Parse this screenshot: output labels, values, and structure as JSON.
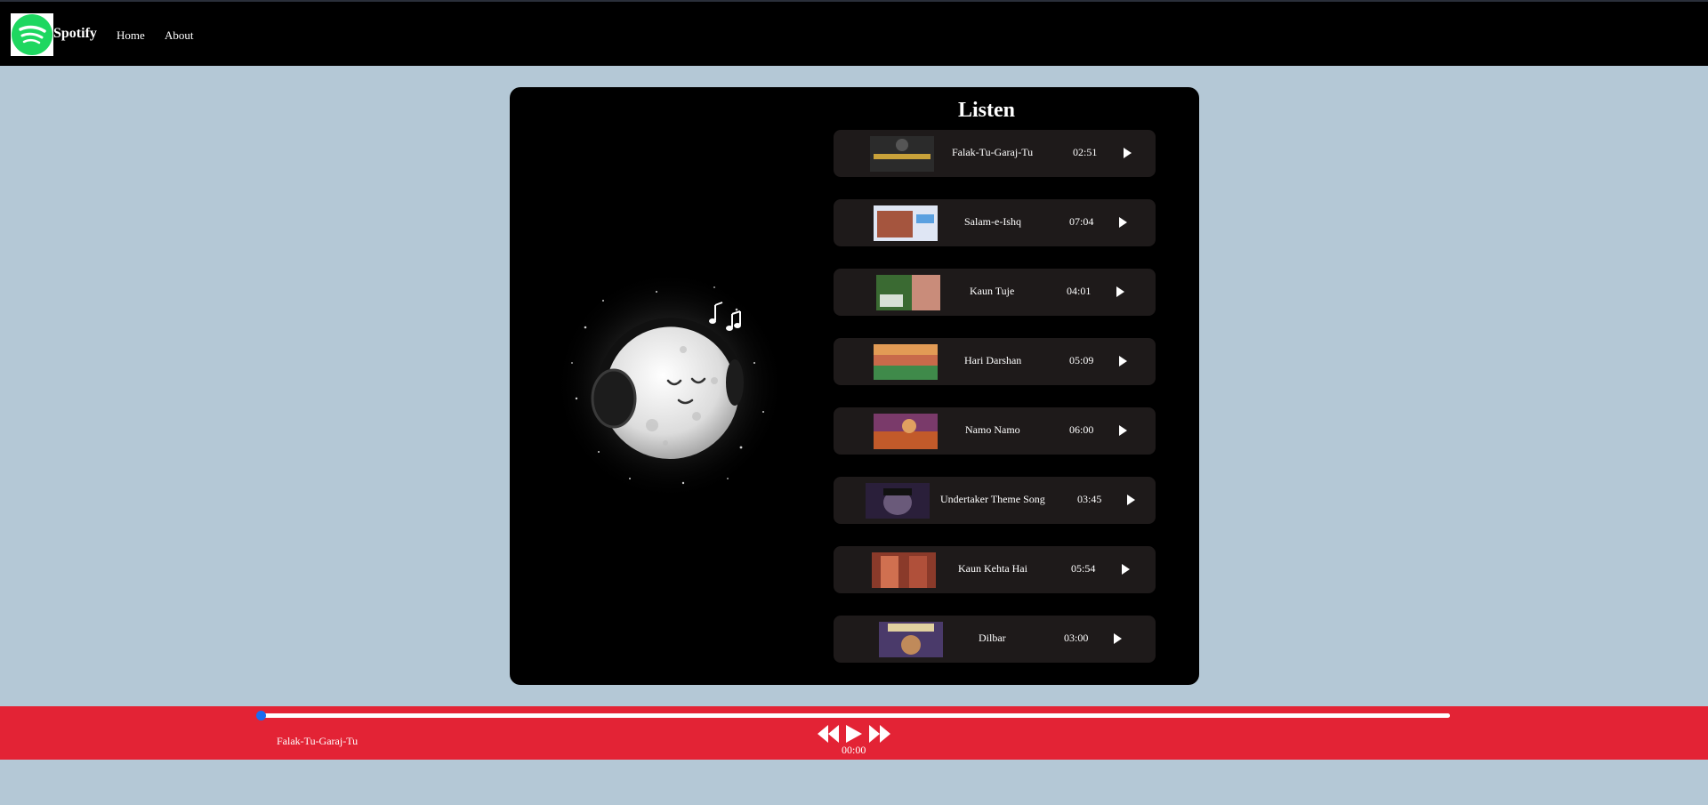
{
  "nav": {
    "brand": "Spotify",
    "links": [
      "Home",
      "About"
    ]
  },
  "playlist": {
    "title": "Listen",
    "songs": [
      {
        "name": "Falak-Tu-Garaj-Tu",
        "duration": "02:51",
        "thumb_color": "#2b2b2b"
      },
      {
        "name": "Salam-e-Ishq",
        "duration": "07:04",
        "thumb_color": "#c9d6ee"
      },
      {
        "name": "Kaun Tuje",
        "duration": "04:01",
        "thumb_color": "#3a6a32"
      },
      {
        "name": "Hari Darshan",
        "duration": "05:09",
        "thumb_color": "#c86a4a"
      },
      {
        "name": "Namo Namo",
        "duration": "06:00",
        "thumb_color": "#7a3a6a"
      },
      {
        "name": "Undertaker Theme Song",
        "duration": "03:45",
        "thumb_color": "#3a2a4a"
      },
      {
        "name": "Kaun Kehta Hai",
        "duration": "05:54",
        "thumb_color": "#8a3a2a"
      },
      {
        "name": "Dilbar",
        "duration": "03:00",
        "thumb_color": "#4a3a6a"
      }
    ]
  },
  "player": {
    "current_song": "Falak-Tu-Garaj-Tu",
    "current_time": "00:00",
    "progress": 0
  },
  "colors": {
    "background": "#b4c8d6",
    "player_bar": "#e32335",
    "song_row": "#1e1a1a",
    "knob": "#1a6cf0",
    "logo_green": "#1ed760"
  }
}
